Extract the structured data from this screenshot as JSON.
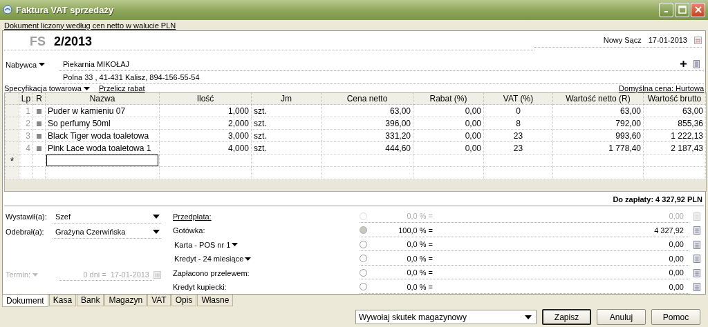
{
  "window": {
    "title": "Faktura VAT sprzedaży"
  },
  "info_bar": "Dokument liczony według cen netto w walucie PLN",
  "document": {
    "type": "FS",
    "number": "2/2013",
    "place": "Nowy Sącz",
    "date": "17-01-2013"
  },
  "buyer": {
    "label": "Nabywca",
    "name": "Piekarnia MIKOŁAJ",
    "address": "Polna  33 , 41-431 Kalisz, 894-156-55-54"
  },
  "spec": {
    "label": "Specyfikacja towarowa",
    "recalc_link": "Przelicz rabat",
    "default_price": "Domyślna cena: Hurtowa"
  },
  "table": {
    "columns": [
      "Lp",
      "R",
      "Nazwa",
      "Ilość",
      "Jm",
      "Cena netto",
      "Rabat (%)",
      "VAT (%)",
      "Wartość netto (R)",
      "Wartość brutto"
    ],
    "rows": [
      {
        "lp": "1",
        "name": "Puder w kamieniu 07",
        "qty": "1,000",
        "unit": "szt.",
        "price": "63,00",
        "discount": "0,00",
        "vat": "0",
        "net": "63,00",
        "gross": "63,00"
      },
      {
        "lp": "2",
        "name": "So perfumy 50ml",
        "qty": "2,000",
        "unit": "szt.",
        "price": "396,00",
        "discount": "0,00",
        "vat": "8",
        "net": "792,00",
        "gross": "855,36"
      },
      {
        "lp": "3",
        "name": "Black Tiger woda toaletowa",
        "qty": "3,000",
        "unit": "szt.",
        "price": "331,20",
        "discount": "0,00",
        "vat": "23",
        "net": "993,60",
        "gross": "1 222,13"
      },
      {
        "lp": "4",
        "name": "Pink Lace woda toaletowa 1",
        "qty": "4,000",
        "unit": "szt.",
        "price": "444,60",
        "discount": "0,00",
        "vat": "23",
        "net": "1 778,40",
        "gross": "2 187,43"
      }
    ],
    "new_row_marker": "*"
  },
  "total": "Do zapłaty: 4 327,92 PLN",
  "people": [
    {
      "label": "Wystawił(a):",
      "value": "Szef"
    },
    {
      "label": "Odebrał(a):",
      "value": "Grażyna Czerwińska"
    }
  ],
  "term": {
    "label": "Termin:",
    "days": "0 dni =",
    "date": "17-01-2013",
    "disabled": true
  },
  "payments": [
    {
      "label": "Przedpłata:",
      "kind": "link",
      "selected": false,
      "disabled": true,
      "percent": "0,0 % =",
      "amount": "0,00"
    },
    {
      "label": "Gotówka:",
      "kind": "plain",
      "selected": true,
      "disabled": false,
      "percent": "100,0 % =",
      "amount": "4 327,92"
    },
    {
      "label": "Karta - POS nr 1",
      "kind": "dropdown",
      "selected": false,
      "disabled": false,
      "percent": "0,0 % =",
      "amount": "0,00"
    },
    {
      "label": "Kredyt - 24 miesiące",
      "kind": "dropdown",
      "selected": false,
      "disabled": false,
      "percent": "0,0 % =",
      "amount": "0,00"
    },
    {
      "label": "Zapłacono przelewem:",
      "kind": "plain",
      "selected": false,
      "disabled": false,
      "percent": "0,0 % =",
      "amount": "0,00"
    },
    {
      "label": "Kredyt kupiecki:",
      "kind": "plain",
      "selected": false,
      "disabled": false,
      "percent": "0,0 % =",
      "amount": "0,00"
    }
  ],
  "tabs": [
    {
      "label": "Dokument",
      "selected": true
    },
    {
      "label": "Kasa",
      "selected": false
    },
    {
      "label": "Bank",
      "selected": false
    },
    {
      "label": "Magazyn",
      "selected": false
    },
    {
      "label": "VAT",
      "selected": false
    },
    {
      "label": "Opis",
      "selected": false
    },
    {
      "label": "Własne",
      "selected": false
    }
  ],
  "action_select": {
    "value": "Wywołaj skutek magazynowy"
  },
  "buttons": [
    {
      "label": "Zapisz",
      "default": true
    },
    {
      "label": "Anuluj",
      "default": false
    },
    {
      "label": "Pomoc",
      "default": false
    }
  ]
}
